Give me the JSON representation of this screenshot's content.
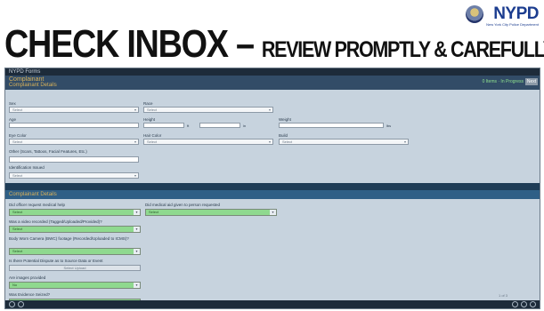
{
  "logo": {
    "word": "NYPD",
    "tagline": "New York City Police Department",
    "seal_icon": "police-seal-icon"
  },
  "headline": {
    "main": "CHECK INBOX",
    "dash": " – ",
    "sub": "REVIEW PROMPTLY & CAREFULLY"
  },
  "app": {
    "topbar": "NYPD Forms",
    "title": "Complainant",
    "subtitle": "Complainant Details",
    "status": "0 Items · In Progress",
    "nav_button": "Next"
  },
  "form": {
    "sex_label": "Sex",
    "sex_value": "Select",
    "race_label": "Race",
    "race_value": "Select",
    "age_label": "Age",
    "height_label": "Height",
    "height_unit_ft": "ft",
    "height_unit_in": "in",
    "weight_label": "Weight",
    "weight_unit": "lbs",
    "eye_label": "Eye Color",
    "eye_value": "Select",
    "hair_label": "Hair Color",
    "hair_value": "Select",
    "build_label": "Build",
    "build_value": "Select",
    "other_label": "Other (Scars, Tattoos, Facial Features, Etc.)",
    "id_label": "Identification Issued",
    "id_value": "Select"
  },
  "section2": {
    "title": "Complainant Details",
    "q1_label": "Did officer request medical help",
    "q1_value": "Select",
    "q2_label": "Did medical aid given to person requested",
    "q2_value": "Select",
    "q3_label": "Was a video recorded (Tagged/Uploaded/Provided)?",
    "q3_value": "Select",
    "q4_label": "Body Worn Camera (BWC) footage (Recorded/Uploaded to ICMS)?",
    "q4_value": "Select",
    "q5_label": "Is there Potential Dispute as to Source Data or Event",
    "q5_value": "Select Upload",
    "q6_label": "Are images provided",
    "q6_value": "No",
    "q7_label": "Was Evidence Seized?"
  },
  "footer": {
    "page": "1 of 3"
  }
}
